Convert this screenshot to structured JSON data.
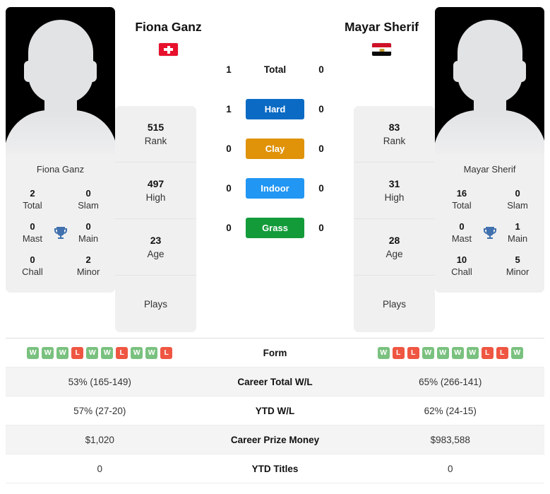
{
  "players": {
    "left": {
      "name": "Fiona Ganz",
      "flag_name": "switzerland-flag",
      "photo_caption": "Fiona Ganz",
      "titles": [
        {
          "value": "2",
          "label": "Total"
        },
        {
          "value": "0",
          "label": "Slam"
        },
        {
          "value": "0",
          "label": "Mast"
        },
        {
          "value": "0",
          "label": "Main"
        },
        {
          "value": "0",
          "label": "Chall"
        },
        {
          "value": "2",
          "label": "Minor"
        }
      ],
      "rank_stats": [
        {
          "value": "515",
          "label": "Rank"
        },
        {
          "value": "497",
          "label": "High"
        },
        {
          "value": "23",
          "label": "Age"
        },
        {
          "value": "",
          "label": "Plays"
        }
      ],
      "form": [
        "W",
        "W",
        "W",
        "L",
        "W",
        "W",
        "L",
        "W",
        "W",
        "L"
      ],
      "career_total_wl": "53% (165-149)",
      "ytd_wl": "57% (27-20)",
      "career_prize_money": "$1,020",
      "ytd_titles": "0"
    },
    "right": {
      "name": "Mayar Sherif",
      "flag_name": "egypt-flag",
      "photo_caption": "Mayar Sherif",
      "titles": [
        {
          "value": "16",
          "label": "Total"
        },
        {
          "value": "0",
          "label": "Slam"
        },
        {
          "value": "0",
          "label": "Mast"
        },
        {
          "value": "1",
          "label": "Main"
        },
        {
          "value": "10",
          "label": "Chall"
        },
        {
          "value": "5",
          "label": "Minor"
        }
      ],
      "rank_stats": [
        {
          "value": "83",
          "label": "Rank"
        },
        {
          "value": "31",
          "label": "High"
        },
        {
          "value": "28",
          "label": "Age"
        },
        {
          "value": "",
          "label": "Plays"
        }
      ],
      "form": [
        "W",
        "L",
        "L",
        "W",
        "W",
        "W",
        "W",
        "L",
        "L",
        "W"
      ],
      "career_total_wl": "65% (266-141)",
      "ytd_wl": "62% (24-15)",
      "career_prize_money": "$983,588",
      "ytd_titles": "0"
    }
  },
  "head_to_head": {
    "rows": [
      {
        "label": "Total",
        "left": "1",
        "right": "0",
        "color": ""
      },
      {
        "label": "Hard",
        "left": "1",
        "right": "0",
        "color": "#0b6bc4"
      },
      {
        "label": "Clay",
        "left": "0",
        "right": "0",
        "color": "#e09209"
      },
      {
        "label": "Indoor",
        "left": "0",
        "right": "0",
        "color": "#2196f3"
      },
      {
        "label": "Grass",
        "left": "0",
        "right": "0",
        "color": "#139b3a"
      }
    ]
  },
  "table": {
    "rows": [
      {
        "label": "Form"
      },
      {
        "label": "Career Total W/L"
      },
      {
        "label": "YTD W/L"
      },
      {
        "label": "Career Prize Money"
      },
      {
        "label": "YTD Titles"
      }
    ]
  },
  "colors": {
    "hard": "#0b6bc4",
    "clay": "#e09209",
    "indoor": "#2196f3",
    "grass": "#139b3a",
    "win_badge": "#7ac17f",
    "loss_badge": "#ef5642",
    "trophy": "#4171ae"
  }
}
